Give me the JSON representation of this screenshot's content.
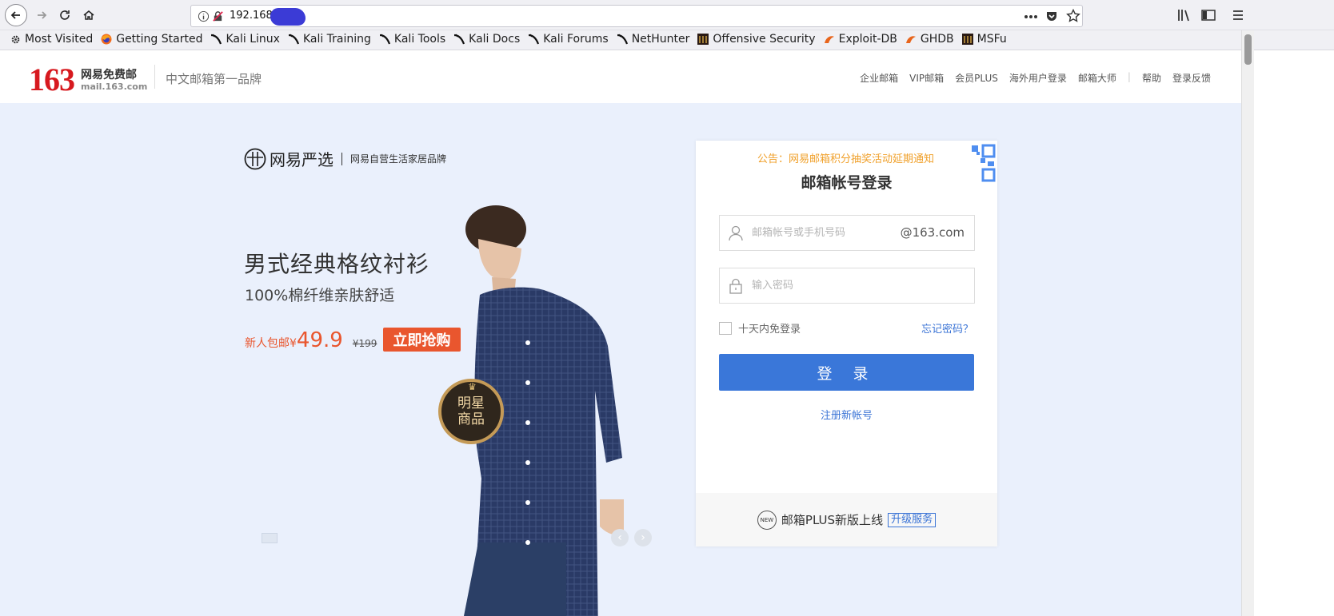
{
  "browser": {
    "url": "192.168.",
    "bookmarks": [
      {
        "label": "Most Visited",
        "icon": "gear-icon"
      },
      {
        "label": "Getting Started",
        "icon": "firefox-icon"
      },
      {
        "label": "Kali Linux",
        "icon": "kali-dragon-icon"
      },
      {
        "label": "Kali Training",
        "icon": "kali-dragon-icon"
      },
      {
        "label": "Kali Tools",
        "icon": "kali-dragon-icon"
      },
      {
        "label": "Kali Docs",
        "icon": "kali-dragon-icon"
      },
      {
        "label": "Kali Forums",
        "icon": "kali-dragon-icon"
      },
      {
        "label": "NetHunter",
        "icon": "kali-dragon-icon"
      },
      {
        "label": "Offensive Security",
        "icon": "offsec-icon"
      },
      {
        "label": "Exploit-DB",
        "icon": "exploitdb-icon"
      },
      {
        "label": "GHDB",
        "icon": "exploitdb-icon"
      },
      {
        "label": "MSFu",
        "icon": "offsec-icon"
      }
    ]
  },
  "header": {
    "logo_num": "163",
    "logo_cn": "网易免费邮",
    "logo_en": "mail.163.com",
    "slogan": "中文邮箱第一品牌",
    "links": [
      "企业邮箱",
      "VIP邮箱",
      "会员PLUS",
      "海外用户登录",
      "邮箱大师",
      "帮助",
      "登录反馈"
    ]
  },
  "promo": {
    "brand": "网易严选",
    "brand_sub": "网易自营生活家居品牌",
    "title": "男式经典格纹衬衫",
    "subtitle": "100%棉纤维亲肤舒适",
    "price_label": "新人包邮¥",
    "price": "49.9",
    "old_price": "¥199",
    "buy_label": "立即抢购",
    "badge_line1": "明星",
    "badge_line2": "商品"
  },
  "login": {
    "notice": "公告：网易邮箱积分抽奖活动延期通知",
    "title": "邮箱帐号登录",
    "username_placeholder": "邮箱帐号或手机号码",
    "domain_suffix": "@163.com",
    "password_placeholder": "输入密码",
    "remember_label": "十天内免登录",
    "forgot_label": "忘记密码？",
    "login_label": "登 录",
    "register_label": "注册新帐号",
    "footer_text": "邮箱PLUS新版上线",
    "upgrade_label": "升级服务",
    "new_badge": "NEW"
  },
  "colors": {
    "brand_red": "#d7191f",
    "primary_blue": "#3a77d9",
    "promo_orange": "#e9562e",
    "notice_orange": "#f0a02a",
    "hero_bg": "#eaf0fc"
  }
}
